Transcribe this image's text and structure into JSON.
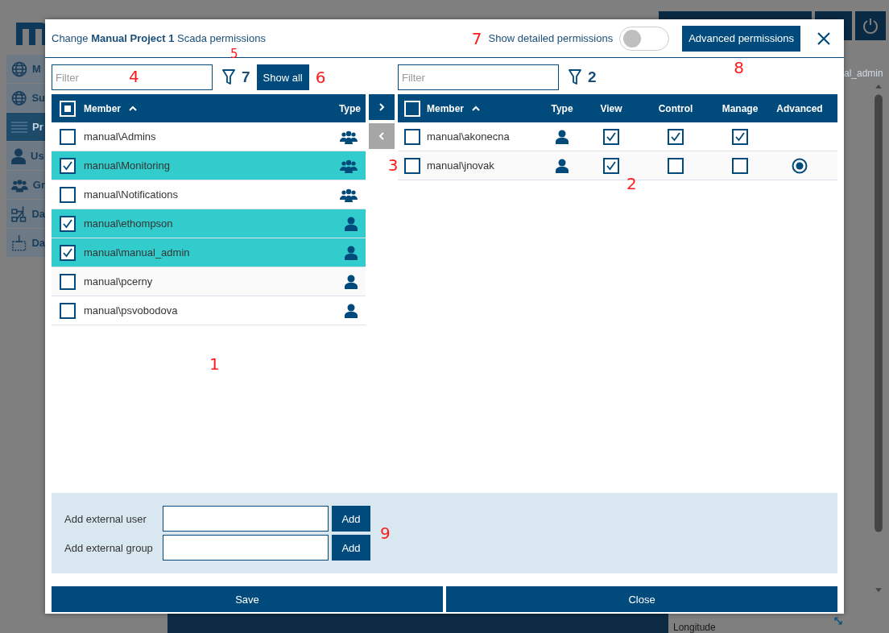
{
  "backdrop": {
    "sidebar": [
      {
        "label": "M",
        "kind": "globe",
        "selected": false
      },
      {
        "label": "Su",
        "kind": "globe",
        "selected": false
      },
      {
        "label": "Pr",
        "kind": "list",
        "selected": true
      },
      {
        "label": "Us",
        "kind": "user",
        "selected": false
      },
      {
        "label": "Gr",
        "kind": "group",
        "selected": false
      },
      {
        "label": "Da",
        "kind": "diagram",
        "selected": false
      },
      {
        "label": "Da",
        "kind": "device",
        "selected": false
      }
    ],
    "user_label": "al_admin",
    "field_label": "Longitude"
  },
  "dialog": {
    "title": "Change **Manual Project 1** Scada permissions",
    "toggle": {
      "label": "Show detailed permissions",
      "on": false,
      "marker": "7"
    },
    "advanced_button": {
      "label": "Advanced permissions",
      "marker": "8"
    }
  },
  "left": {
    "filter": {
      "placeholder": "Filter",
      "marker": "4"
    },
    "count": "7",
    "count_marker": "5",
    "show_all": {
      "label": "Show all",
      "marker": "6"
    },
    "columns": [
      "Member",
      "Type"
    ],
    "header_indeterminate": true,
    "marker": "1",
    "rows": [
      {
        "name": "manual\\Admins",
        "kind": "group",
        "checked": false
      },
      {
        "name": "manual\\Monitoring",
        "kind": "group",
        "checked": true
      },
      {
        "name": "manual\\Notifications",
        "kind": "group",
        "checked": false
      },
      {
        "name": "manual\\ethompson",
        "kind": "user",
        "checked": true
      },
      {
        "name": "manual\\manual_admin",
        "kind": "user",
        "checked": true
      },
      {
        "name": "manual\\pcerny",
        "kind": "user",
        "checked": false
      },
      {
        "name": "manual\\psvobodova",
        "kind": "user",
        "checked": false
      }
    ]
  },
  "transfer": {
    "marker": "3",
    "add_disabled": false,
    "remove_disabled": true
  },
  "right": {
    "filter": {
      "placeholder": "Filter"
    },
    "count": "2",
    "marker": "2",
    "header_checked": false,
    "columns": [
      "Member",
      "Type",
      "View",
      "Control",
      "Manage",
      "Advanced"
    ],
    "rows": [
      {
        "name": "manual\\akonecna",
        "kind": "user",
        "checked": false,
        "view": true,
        "control": true,
        "manage": true,
        "advanced": false
      },
      {
        "name": "manual\\jnovak",
        "kind": "user",
        "checked": false,
        "view": true,
        "control": false,
        "manage": false,
        "advanced": true
      }
    ]
  },
  "external": {
    "marker": "9",
    "rows": [
      {
        "label": "Add external user",
        "button": "Add"
      },
      {
        "label": "Add external group",
        "button": "Add"
      }
    ]
  },
  "footer": {
    "buttons": [
      "Save",
      "Close"
    ]
  }
}
